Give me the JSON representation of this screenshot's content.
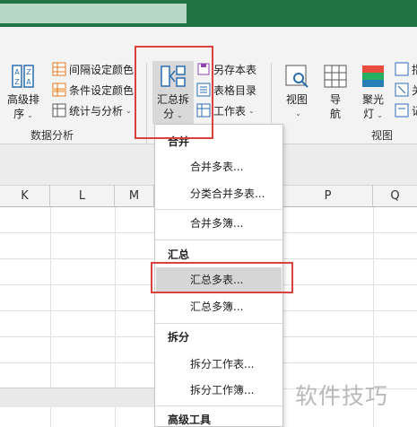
{
  "ribbon": {
    "sort": {
      "label_line1": "高级排",
      "label_line2": "序"
    },
    "data_analysis": {
      "interval_color": "间隔设定颜色",
      "condition_color": "条件设定颜色",
      "stats": "统计与分析",
      "group_label": "数据分析"
    },
    "merge_split": {
      "label_line1": "汇总拆",
      "label_line2": "分"
    },
    "misc": {
      "save_copy": "另存本表",
      "table_toc": "表格目录",
      "worksheet": "工作表"
    },
    "view": {
      "view_label": "视图",
      "nav_line1": "导",
      "nav_line2": "航",
      "spotlight_line1": "聚光",
      "spotlight_line2": "灯",
      "group_label": "视图",
      "extra1": "指",
      "extra2": "关",
      "extra3": "记"
    }
  },
  "sheet": {
    "columns": [
      "K",
      "L",
      "M",
      "P",
      "Q"
    ]
  },
  "menu": {
    "sections": [
      {
        "header": "合并",
        "items": [
          "合并多表...",
          "分类合并多表...",
          "合并多簿..."
        ]
      },
      {
        "header": "汇总",
        "items": [
          "汇总多表...",
          "汇总多簿..."
        ]
      },
      {
        "header": "拆分",
        "items": [
          "拆分工作表...",
          "拆分工作簿..."
        ]
      },
      {
        "header": "高级工具",
        "items": []
      }
    ],
    "hovered_item": "汇总多表..."
  },
  "watermark": "软件技巧",
  "colors": {
    "titlebar": "#217346",
    "highlight": "#d9423f",
    "menu_hover": "#d6d6d6"
  }
}
